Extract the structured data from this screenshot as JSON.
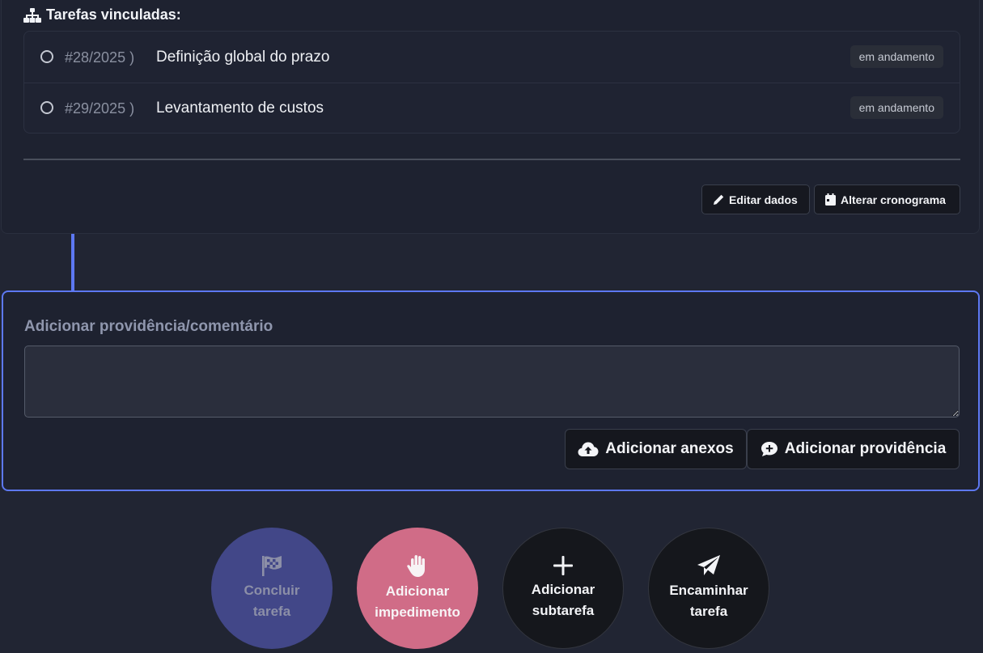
{
  "linked_tasks": {
    "title": "Tarefas vinculadas:",
    "items": [
      {
        "number": "#28/2025 )",
        "title": "Definição global do prazo",
        "status": "em andamento"
      },
      {
        "number": "#29/2025 )",
        "title": "Levantamento de custos",
        "status": "em andamento"
      }
    ],
    "edit_label": "Editar dados",
    "schedule_label": "Alterar cronograma"
  },
  "comment": {
    "label": "Adicionar providência/comentário",
    "value": "",
    "attach_label": "Adicionar anexos",
    "add_label": "Adicionar providência"
  },
  "actions": [
    {
      "line1": "Concluir",
      "line2": "tarefa",
      "icon": "flag-checkered-icon",
      "color": "#424788"
    },
    {
      "line1": "Adicionar",
      "line2": "impedimento",
      "icon": "hand-icon",
      "color": "#d06c87"
    },
    {
      "line1": "Adicionar",
      "line2": "subtarefa",
      "icon": "plus-icon",
      "color": "#15171c"
    },
    {
      "line1": "Encaminhar",
      "line2": "tarefa",
      "icon": "paper-plane-icon",
      "color": "#15171c"
    }
  ],
  "colors": {
    "accent": "#5d78f2",
    "background": "#212533"
  }
}
